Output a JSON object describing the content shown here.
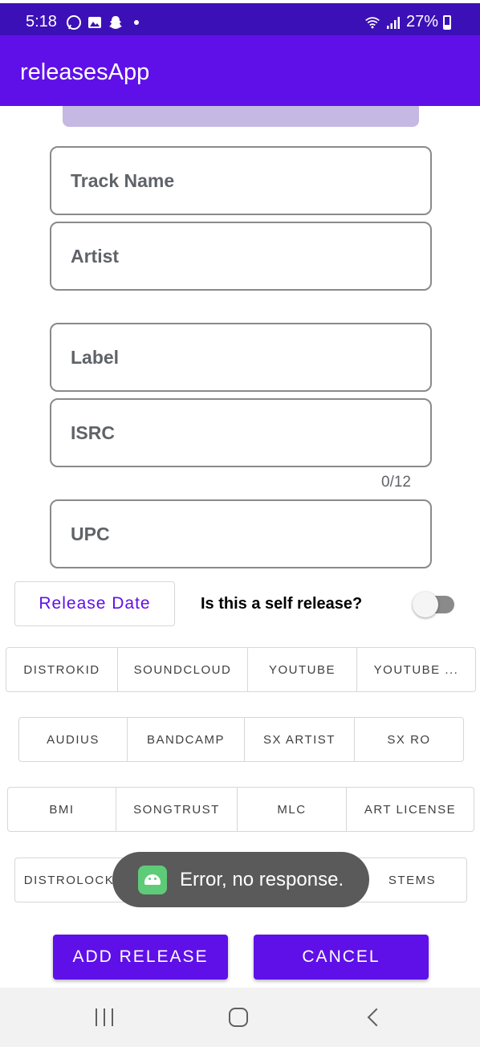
{
  "status_bar": {
    "time": "5:18",
    "battery": "27%",
    "icons": [
      "whatsapp-icon",
      "gallery-icon",
      "snapchat-icon",
      "dot-icon",
      "wifi-icon",
      "signal-icon",
      "battery-icon"
    ]
  },
  "app_bar": {
    "title": "releasesApp"
  },
  "form": {
    "track_name_placeholder": "Track Name",
    "artist_placeholder": "Artist",
    "label_placeholder": "Label",
    "isrc_placeholder": "ISRC",
    "isrc_counter": "0/12",
    "upc_placeholder": "UPC"
  },
  "release_date_label": "Release Date",
  "self_release": {
    "label": "Is this a self release?",
    "checked": false
  },
  "chip_rows": [
    [
      "DISTROKID",
      "SOUNDCLOUD",
      "YOUTUBE",
      "YOUTUBE ..."
    ],
    [
      "AUDIUS",
      "BANDCAMP",
      "SX ARTIST",
      "SX RO"
    ],
    [
      "BMI",
      "SONGTRUST",
      "MLC",
      "ART LICENSE"
    ],
    [
      "DISTROLOCK",
      "",
      "",
      "STEMS"
    ]
  ],
  "toast": {
    "message": "Error, no response."
  },
  "actions": {
    "add_label": "ADD RELEASE",
    "cancel_label": "CANCEL"
  },
  "colors": {
    "status_bar": "#3c10b7",
    "app_bar": "#5f10e8",
    "accent": "#5f10e8",
    "toast": "#5a5a5a"
  }
}
